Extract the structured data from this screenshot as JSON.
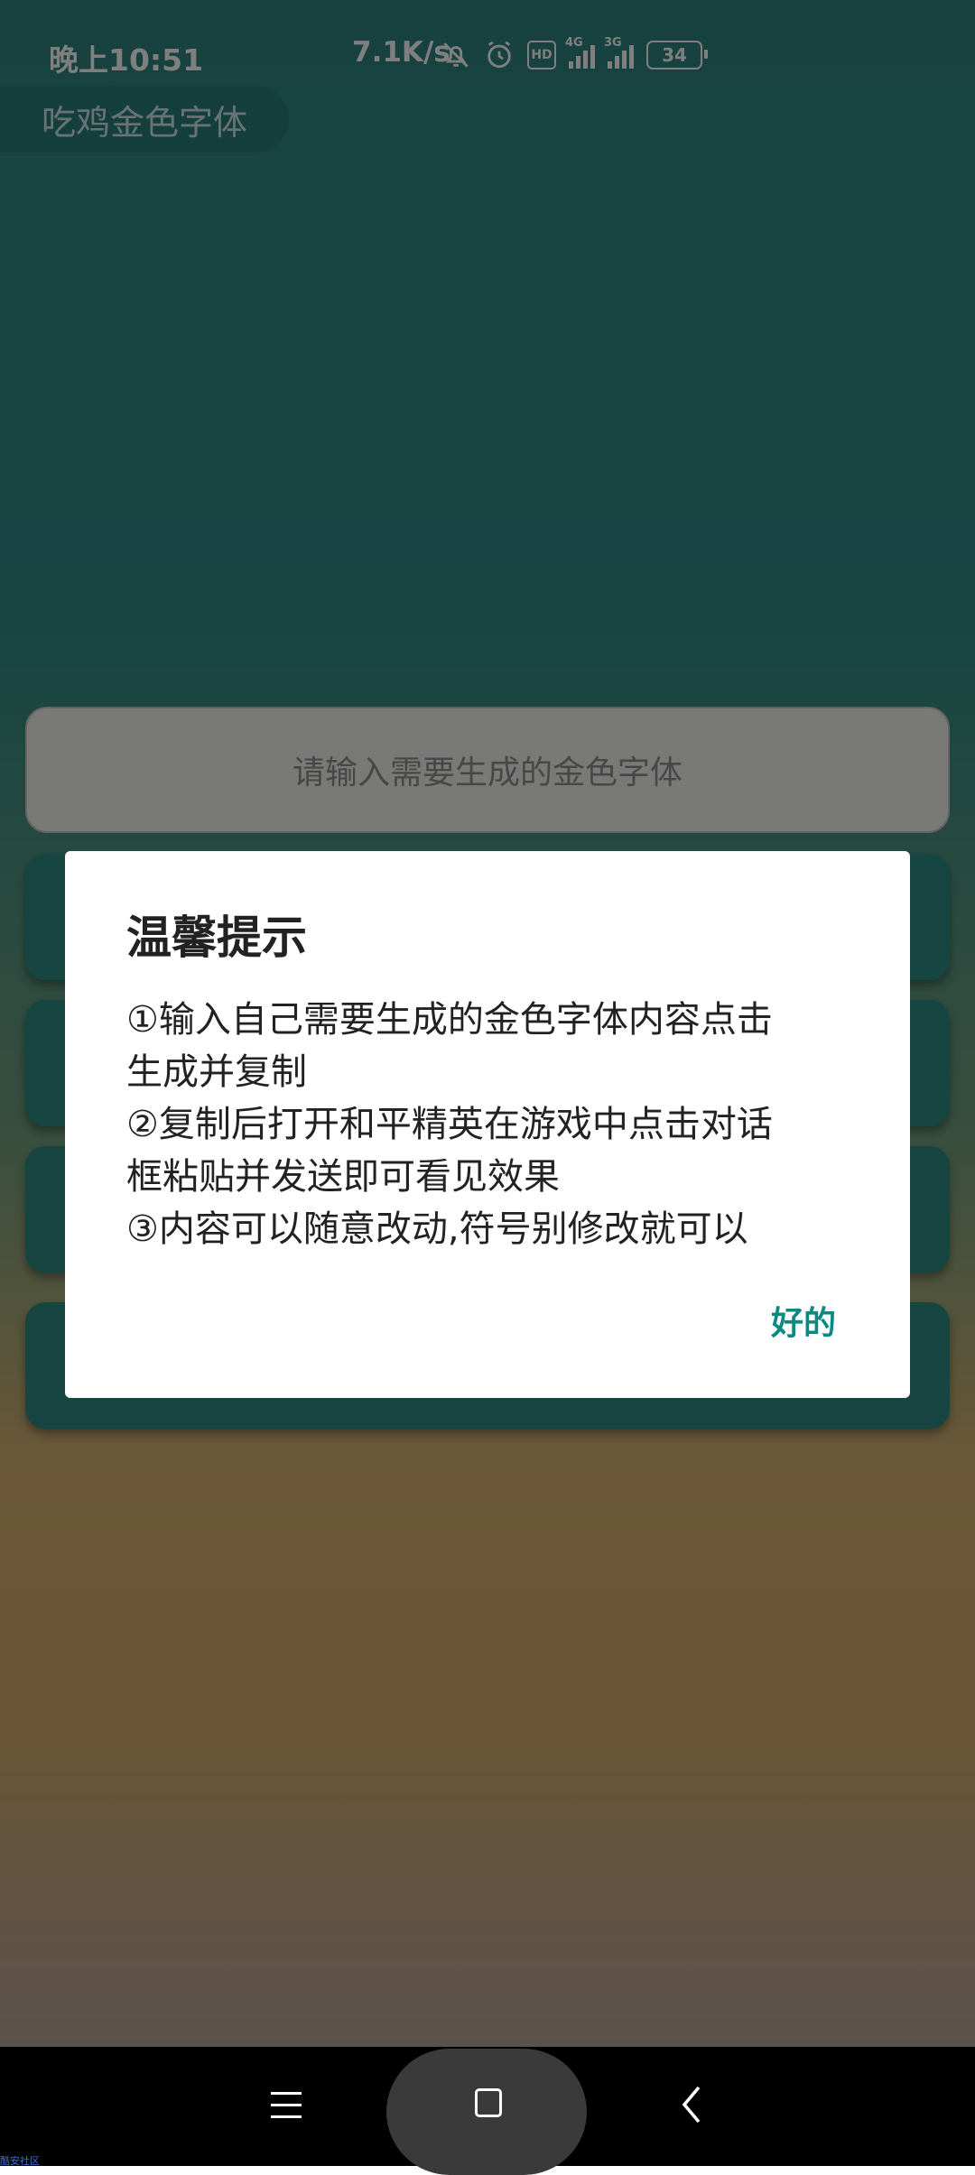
{
  "status_bar": {
    "time": "晚上10:51",
    "net_speed": "7.1K/s",
    "icons": [
      "bell-off-icon",
      "alarm-icon",
      "hd-icon",
      "signal-4g-icon",
      "signal-3g-icon",
      "battery-icon"
    ],
    "signal1_tag": "4G",
    "signal2_tag": "3G",
    "hd_label": "HD",
    "battery": "34"
  },
  "app": {
    "title": "吃鸡金色字体",
    "input_placeholder": "请输入需要生成的金色字体"
  },
  "dialog": {
    "title": "温馨提示",
    "lines": [
      "①输入自己需要生成的金色字体内容点击",
      "生成并复制",
      "②复制后打开和平精英在游戏中点击对话",
      "框粘贴并发送即可看见效果",
      "③内容可以随意改动,符号别修改就可以"
    ],
    "ok_label": "好的"
  },
  "watermark": "酷安社区",
  "colors": {
    "accent": "#0b8a7f",
    "teal": "#2e8580",
    "gold": "#d8b170"
  }
}
